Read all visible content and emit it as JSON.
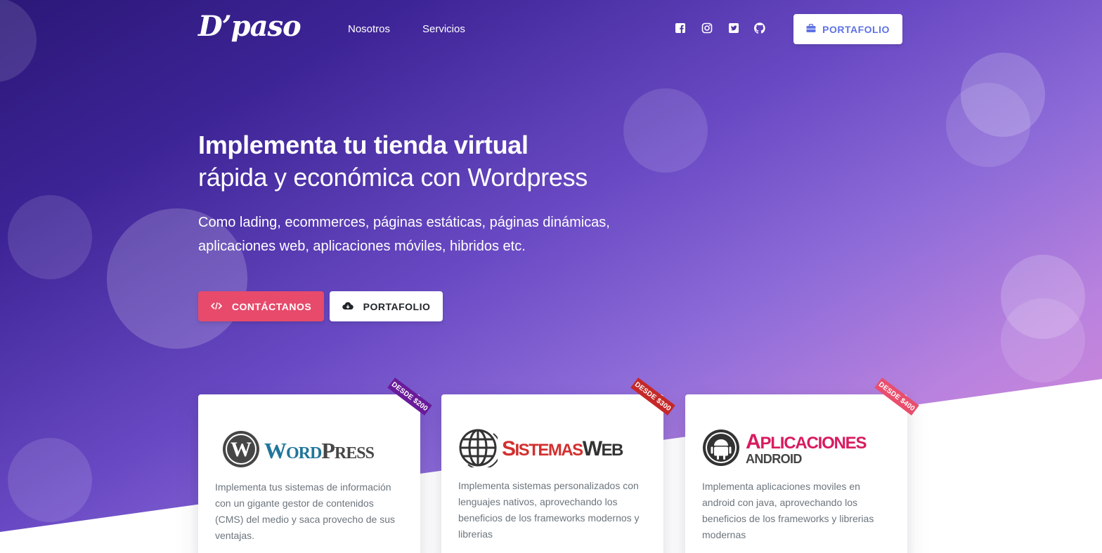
{
  "brand": {
    "logo_text": "D’paso"
  },
  "nav": {
    "links": [
      "Nosotros",
      "Servicios"
    ],
    "social": [
      "facebook-icon",
      "instagram-icon",
      "twitter-icon",
      "github-icon"
    ],
    "cta_label": "PORTAFOLIO",
    "cta_icon": "briefcase-icon"
  },
  "hero": {
    "title": "Implementa tu tienda virtual",
    "subtitle": "rápida y económica con Wordpress",
    "description": "Como lading, ecommerces, páginas estáticas, páginas dinámicas, aplicaciones web, aplicaciones móviles, hibridos etc.",
    "btn_contact": "CONTÁCTANOS",
    "btn_contact_icon": "code-icon",
    "btn_portfolio": "PORTAFOLIO",
    "btn_portfolio_icon": "cloud-download-icon"
  },
  "cards": [
    {
      "logo": {
        "first": "W",
        "rest_a": "ORD",
        "second": "P",
        "rest_b": "RESS"
      },
      "ribbon": "DESDE $200",
      "ribbon_color": "#6a1b9a",
      "text": "Implementa tus sistemas de información con un gigante gestor de contenidos (CMS) del medio y saca provecho de sus ventajas."
    },
    {
      "logo": {
        "first": "S",
        "rest_a": "ISTEMAS",
        "second": "W",
        "rest_b": "EB"
      },
      "ribbon": "DESDE $300",
      "ribbon_color": "#c62828",
      "text": "Implementa sistemas personalizados con lenguajes nativos, aprovechando los beneficios de los frameworks modernos y librerias"
    },
    {
      "logo": {
        "first": "A",
        "rest_a": "PLICACIONES",
        "second": "ANDROID"
      },
      "ribbon": "DESDE $400",
      "ribbon_color": "#e94e6d",
      "text": "Implementa aplicaciones moviles en android con java, aprovechando los beneficios de los frameworks y librerias modernas"
    }
  ],
  "colors": {
    "accent": "#5e72e4",
    "contact_button": "#e74a6b",
    "wordpress_blue": "#21759b",
    "sistemas_red": "#d32f2f"
  }
}
